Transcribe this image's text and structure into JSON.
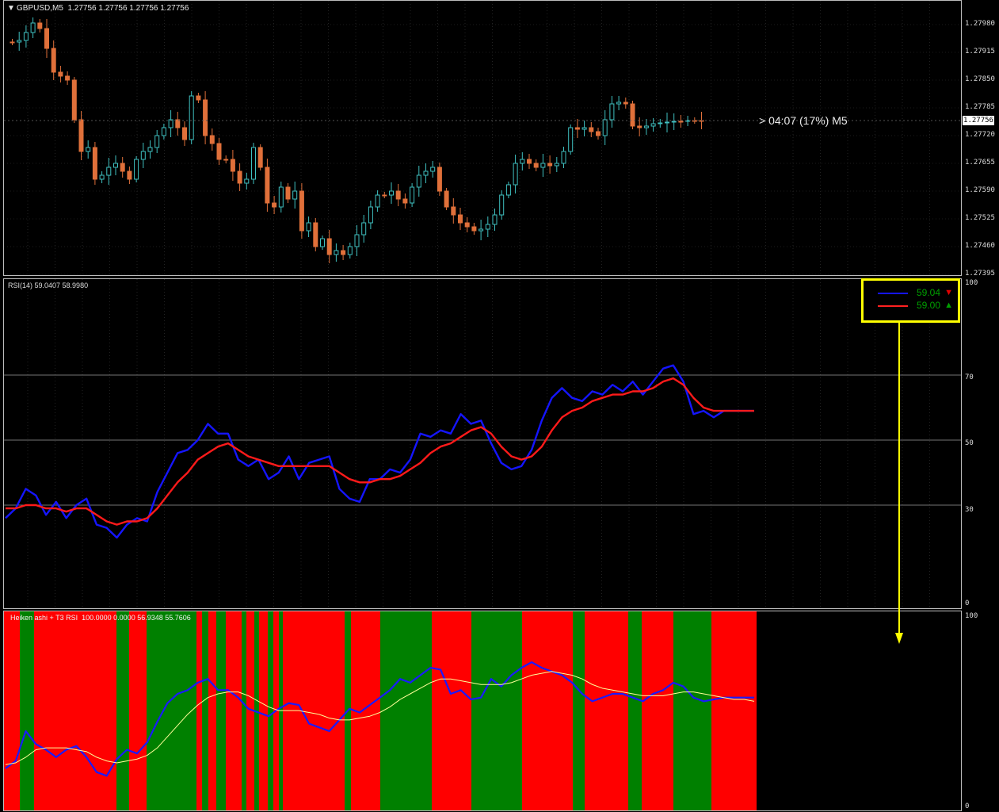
{
  "main_chart": {
    "symbol_line": "GBPUSD,M5  1.27756 1.27756 1.27756 1.27756",
    "countdown": "> 04:07 (17%) M5",
    "current_price_badge": "1.27756",
    "y_ticks": [
      "1.27980",
      "1.27915",
      "1.27850",
      "1.27785",
      "1.27720",
      "1.27655",
      "1.27590",
      "1.27525",
      "1.27460",
      "1.27395"
    ],
    "bull_color": "#3fc0c0",
    "bear_color": "#e0703a"
  },
  "rsi_panel": {
    "title": "RSI(14) 59.0407 58.9980",
    "y_ticks": [
      "100",
      "70",
      "50",
      "30",
      "0"
    ],
    "legend": {
      "items": [
        {
          "value": "59.04",
          "line_color": "#1515ff",
          "arrow": "▼",
          "arrow_color": "#e00000"
        },
        {
          "value": "59.00",
          "line_color": "#ff2020",
          "arrow": "▲",
          "arrow_color": "#00a000"
        }
      ]
    }
  },
  "ha_panel": {
    "title": "Heiken ashi + T3 RSI  100.0000 0.0000 56.9348 55.7606",
    "y_ticks": [
      "100",
      "0"
    ]
  },
  "chart_data": [
    {
      "type": "line",
      "title": "RSI(14) 59.0407 58.9980",
      "ylim": [
        0,
        100
      ],
      "series": [
        {
          "values": [
            26,
            29,
            35,
            33,
            27,
            31,
            26,
            30,
            32,
            24,
            23,
            20,
            24,
            26,
            25,
            34,
            40,
            46,
            47,
            50,
            55,
            52,
            52,
            44,
            42,
            44,
            38,
            40,
            45,
            38,
            43,
            44,
            45,
            35,
            32,
            31,
            38,
            38,
            41,
            40,
            44,
            52,
            51,
            53,
            52,
            58,
            55,
            56,
            49,
            43,
            41,
            42,
            47,
            56,
            63,
            66,
            63,
            62,
            65,
            64,
            67,
            65,
            68,
            64,
            68,
            72,
            73,
            68,
            58,
            59,
            57,
            59,
            59,
            59,
            59
          ]
        },
        {
          "values": [
            29,
            29,
            30,
            30,
            29,
            29,
            28,
            29,
            29,
            27,
            25,
            24,
            25,
            25,
            26,
            29,
            33,
            37,
            40,
            44,
            46,
            48,
            49,
            47,
            45,
            44,
            43,
            42,
            42,
            42,
            42,
            42,
            42,
            40,
            38,
            37,
            37,
            38,
            38,
            39,
            41,
            43,
            46,
            48,
            49,
            51,
            53,
            54,
            52,
            48,
            45,
            44,
            45,
            48,
            53,
            57,
            59,
            60,
            62,
            63,
            64,
            64,
            65,
            65,
            66,
            68,
            69,
            67,
            63,
            60,
            59,
            59,
            59,
            59,
            59
          ]
        }
      ]
    },
    {
      "type": "line",
      "title": "Heiken ashi + T3 RSI  100.0000 0.0000 56.9348 55.7606",
      "ylim": [
        0,
        100
      ],
      "series": [
        {
          "values": [
            20,
            24,
            40,
            33,
            30,
            26,
            30,
            32,
            26,
            18,
            16,
            25,
            30,
            28,
            34,
            45,
            55,
            60,
            62,
            66,
            68,
            62,
            62,
            58,
            52,
            50,
            48,
            52,
            55,
            54,
            44,
            42,
            40,
            46,
            52,
            50,
            54,
            58,
            62,
            68,
            66,
            70,
            74,
            73,
            60,
            62,
            57,
            58,
            68,
            64,
            70,
            74,
            77,
            74,
            72,
            70,
            66,
            60,
            56,
            58,
            60,
            60,
            58,
            56,
            60,
            62,
            66,
            64,
            58,
            56,
            57,
            58,
            58,
            58,
            58
          ]
        },
        {
          "values": [
            22,
            23,
            26,
            30,
            31,
            31,
            31,
            30,
            29,
            26,
            24,
            23,
            24,
            25,
            27,
            31,
            37,
            43,
            49,
            54,
            58,
            60,
            61,
            61,
            59,
            56,
            53,
            51,
            51,
            51,
            50,
            49,
            47,
            46,
            46,
            47,
            48,
            50,
            53,
            57,
            60,
            63,
            66,
            68,
            68,
            67,
            66,
            65,
            65,
            65,
            66,
            68,
            70,
            71,
            72,
            71,
            70,
            68,
            65,
            63,
            62,
            61,
            60,
            59,
            59,
            59,
            60,
            61,
            61,
            60,
            59,
            58,
            57,
            57,
            56
          ]
        }
      ]
    }
  ]
}
